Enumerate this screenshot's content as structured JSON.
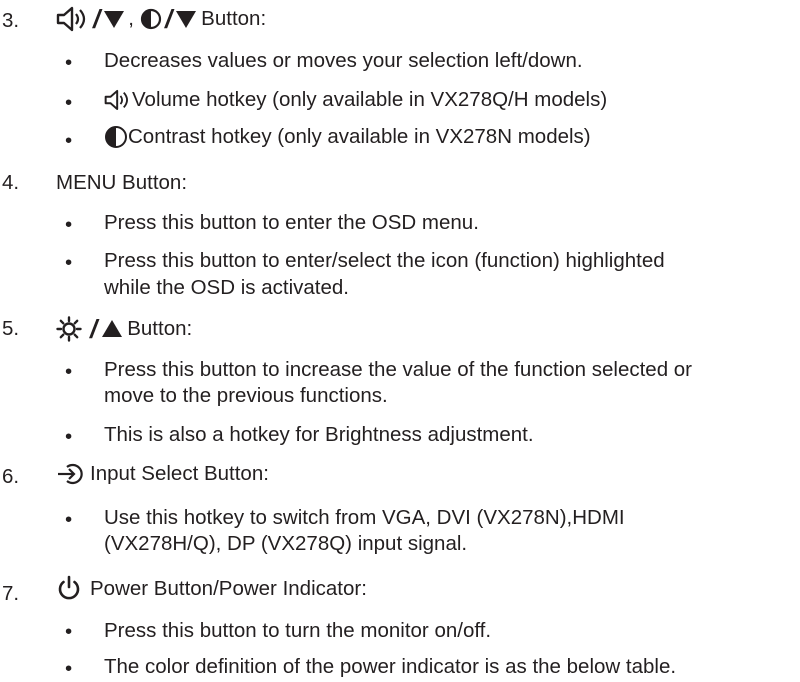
{
  "items": [
    {
      "number": "3.",
      "label": "Button:",
      "bullets": [
        "Decreases values or moves your selection left/down.",
        "Volume hotkey (only available in VX278Q/H models)",
        "Contrast hotkey (only available in VX278N models)"
      ]
    },
    {
      "number": "4.",
      "label": "MENU Button:",
      "bullets": [
        "Press this button to enter the OSD menu.",
        "Press this button to enter/select the icon (function) highlighted",
        "while the OSD is activated."
      ]
    },
    {
      "number": "5.",
      "label": "Button:",
      "bullets": [
        "Press this button to increase the value of the function selected or",
        "move to the previous functions.",
        "This is also a hotkey for Brightness adjustment."
      ]
    },
    {
      "number": "6.",
      "label": "Input Select Button:",
      "bullets": [
        "Use this hotkey to switch from VGA, DVI (VX278N),HDMI",
        "(VX278H/Q), DP (VX278Q) input signal."
      ]
    },
    {
      "number": "7.",
      "label": "Power Button/Power Indicator:",
      "bullets": [
        "Press this button to turn the monitor on/off.",
        "The color definition of the power indicator is as the below table."
      ]
    }
  ],
  "bullet_char": "•",
  "separators": {
    "slash": "/",
    "comma": ","
  },
  "icons": [
    "speaker-icon",
    "down-triangle-icon",
    "contrast-icon",
    "brightness-icon",
    "up-triangle-icon",
    "input-icon",
    "power-icon"
  ]
}
